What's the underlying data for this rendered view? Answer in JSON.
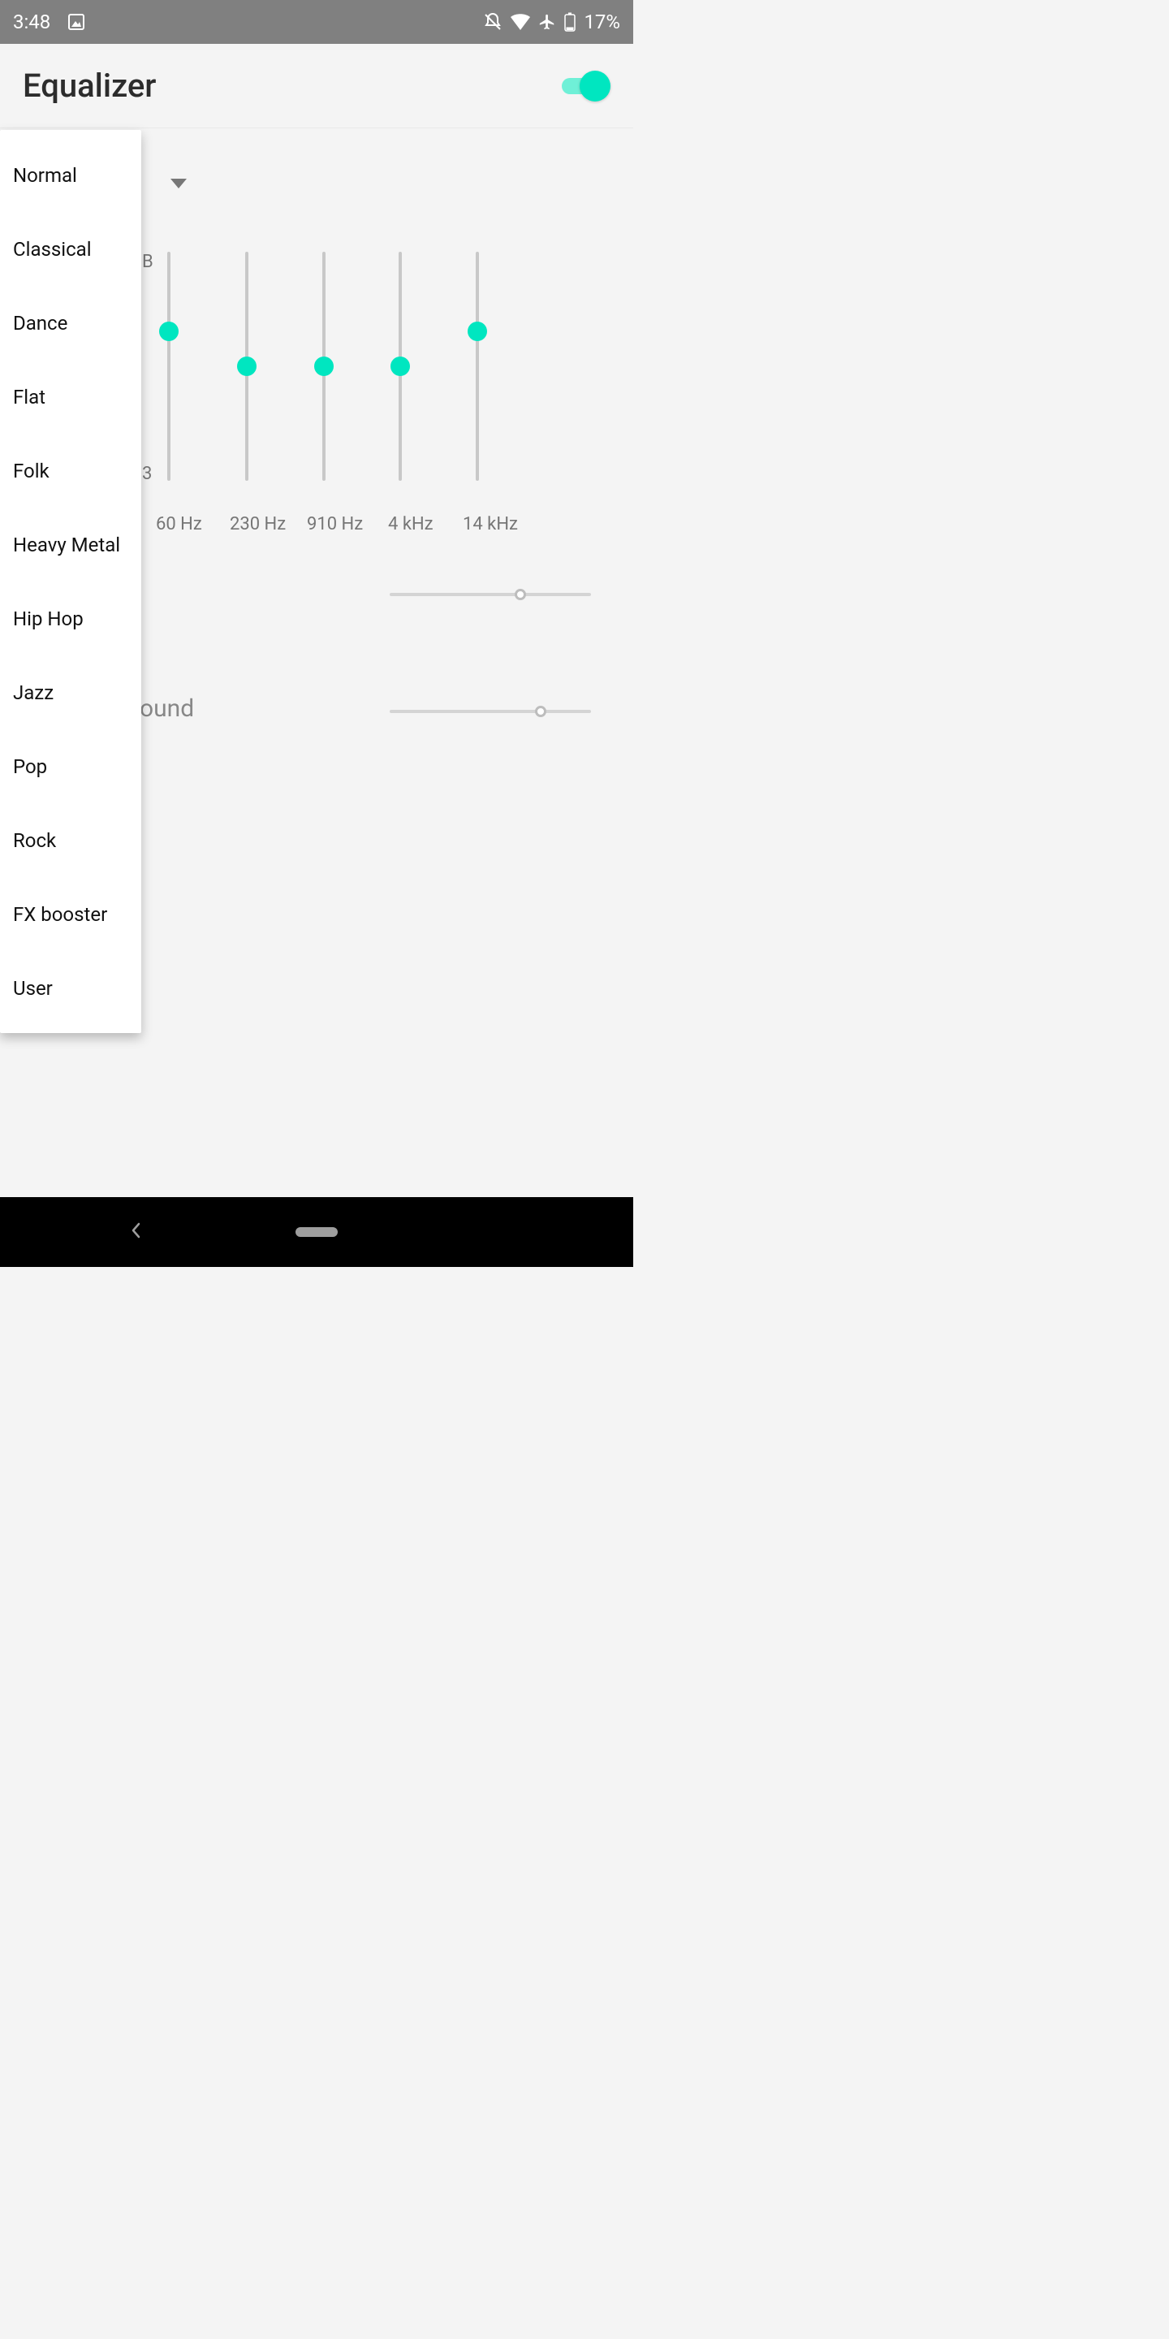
{
  "statusbar": {
    "time": "3:48",
    "battery_pct": "17%"
  },
  "header": {
    "title": "Equalizer",
    "toggle_on": true
  },
  "scale": {
    "top": "B",
    "bottom": "3"
  },
  "eq": {
    "bands": [
      {
        "freq": "60 Hz",
        "value_pct": 65
      },
      {
        "freq": "230 Hz",
        "value_pct": 50
      },
      {
        "freq": "910 Hz",
        "value_pct": 50
      },
      {
        "freq": "4 kHz",
        "value_pct": 50
      },
      {
        "freq": "14 kHz",
        "value_pct": 65
      }
    ]
  },
  "hsliders": {
    "surround_partial_label": "ound",
    "top_value_pct": 65,
    "bot_value_pct": 75
  },
  "menu": {
    "items": [
      "Normal",
      "Classical",
      "Dance",
      "Flat",
      "Folk",
      "Heavy Metal",
      "Hip Hop",
      "Jazz",
      "Pop",
      "Rock",
      "FX booster",
      "User"
    ]
  }
}
